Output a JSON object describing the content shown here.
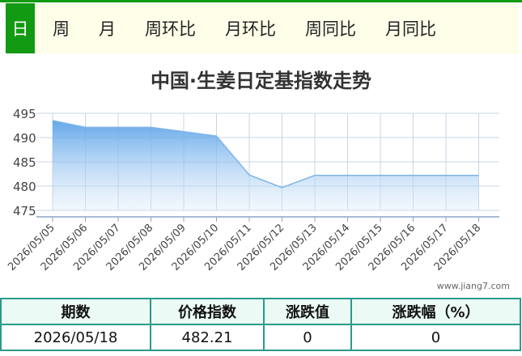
{
  "tabs": [
    {
      "label": "日",
      "active": true
    },
    {
      "label": "周",
      "active": false
    },
    {
      "label": "月",
      "active": false
    },
    {
      "label": "周环比",
      "active": false
    },
    {
      "label": "月环比",
      "active": false
    },
    {
      "label": "周同比",
      "active": false
    },
    {
      "label": "月同比",
      "active": false
    }
  ],
  "watermark": "www.jiang7.com",
  "colors": {
    "accent": "#139a13",
    "line": "#7fb4e6",
    "table_border": "#2a9a8a"
  },
  "chart_data": {
    "type": "area",
    "title": "中国·生姜日定基指数走势",
    "xlabel": "",
    "ylabel": "",
    "ylim": [
      475,
      495
    ],
    "yticks": [
      495,
      490,
      485,
      480,
      475
    ],
    "grid": true,
    "x": [
      "2026/05/05",
      "2026/05/06",
      "2026/05/07",
      "2026/05/08",
      "2026/05/09",
      "2026/05/10",
      "2026/05/11",
      "2026/05/12",
      "2026/05/13",
      "2026/05/14",
      "2026/05/15",
      "2026/05/16",
      "2026/05/17",
      "2026/05/18"
    ],
    "series": [
      {
        "values": [
          493.5,
          492.1,
          492.1,
          492.1,
          491.2,
          490.3,
          482.3,
          479.7,
          482.21,
          482.21,
          482.21,
          482.21,
          482.21,
          482.21
        ]
      }
    ]
  },
  "table": {
    "headers": [
      "期数",
      "价格指数",
      "涨跌值",
      "涨跌幅（%）"
    ],
    "rows": [
      [
        "2026/05/18",
        "482.21",
        "0",
        "0"
      ]
    ]
  }
}
